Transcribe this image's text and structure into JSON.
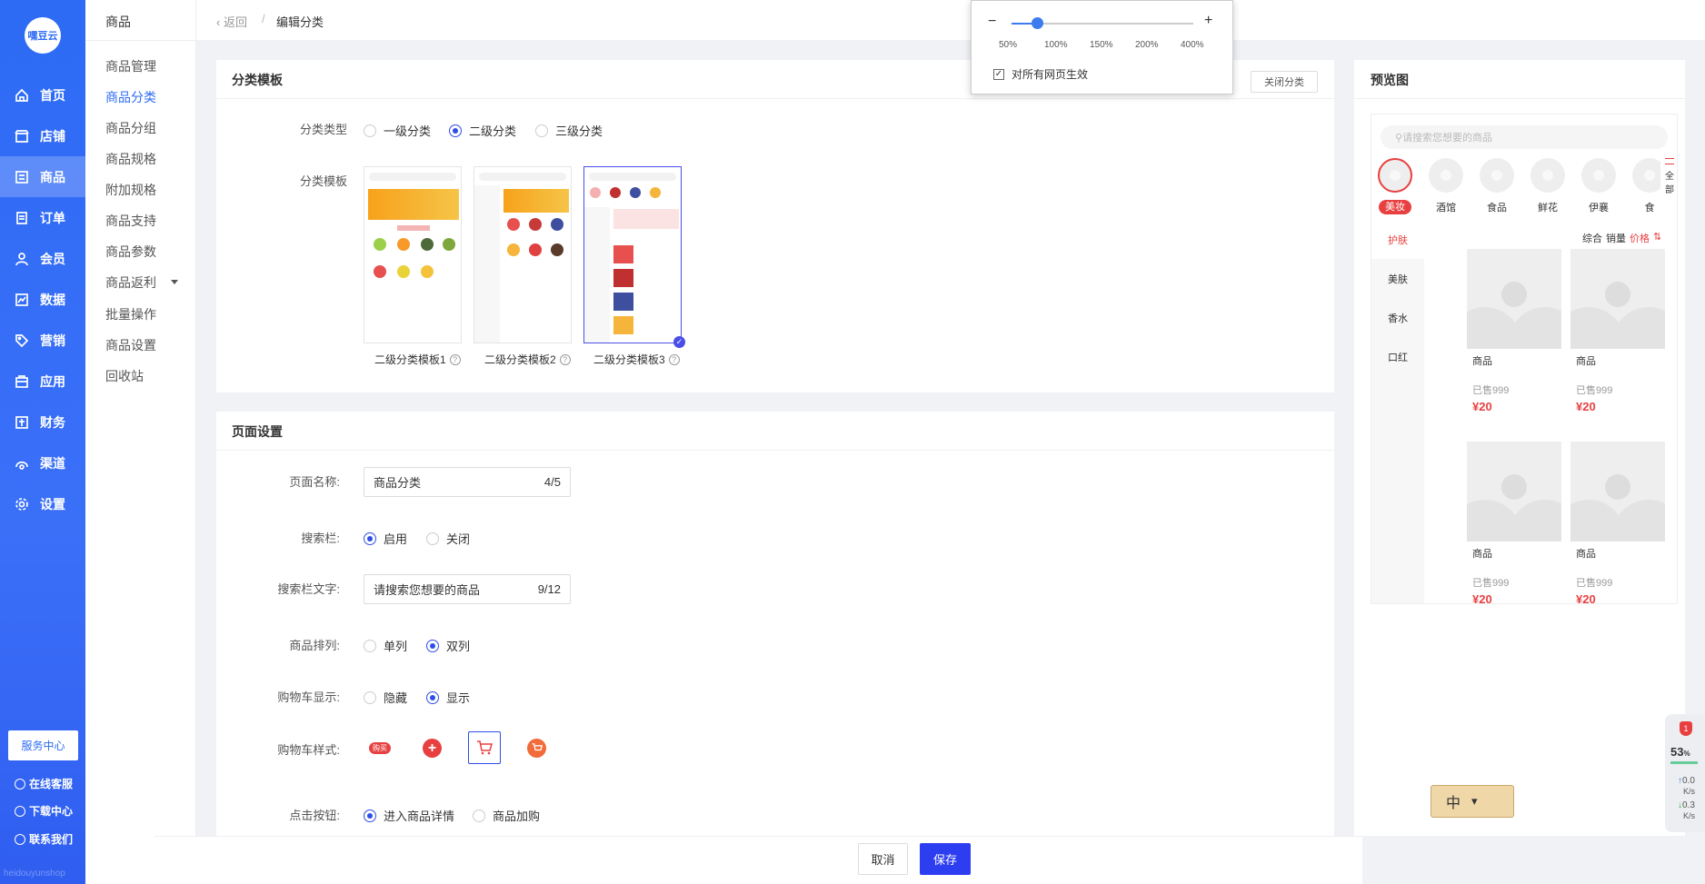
{
  "brand": {
    "logo_text": "嘿豆云",
    "watermark": "heidouyunshop"
  },
  "main_nav": [
    {
      "label": "首页",
      "icon": "home-icon"
    },
    {
      "label": "店铺",
      "icon": "store-icon"
    },
    {
      "label": "商品",
      "icon": "goods-icon",
      "active": true
    },
    {
      "label": "订单",
      "icon": "order-icon"
    },
    {
      "label": "会员",
      "icon": "member-icon"
    },
    {
      "label": "数据",
      "icon": "data-icon"
    },
    {
      "label": "营销",
      "icon": "tag-icon"
    },
    {
      "label": "应用",
      "icon": "app-icon"
    },
    {
      "label": "财务",
      "icon": "finance-icon"
    },
    {
      "label": "渠道",
      "icon": "channel-icon"
    },
    {
      "label": "设置",
      "icon": "gear-icon"
    }
  ],
  "sidebar_bottom": {
    "service_center": "服务中心",
    "links": [
      "在线客服",
      "下载中心",
      "联系我们"
    ]
  },
  "subnav": {
    "title": "商品",
    "items": [
      "商品管理",
      "商品分类",
      "商品分组",
      "商品规格",
      "附加规格",
      "商品支持",
      "商品参数",
      "商品返利",
      "批量操作",
      "商品设置",
      "回收站"
    ],
    "active_index": 1
  },
  "breadcrumb": {
    "back": "返回",
    "sep": "/",
    "current": "编辑分类"
  },
  "zoom_popup": {
    "minus": "−",
    "plus": "+",
    "ticks": [
      "50%",
      "100%",
      "150%",
      "200%",
      "400%"
    ],
    "level_fraction": 0.14,
    "apply_all_label": "对所有网页生效",
    "apply_all_checked": true
  },
  "category_template": {
    "title": "分类模板",
    "close_button": "关闭分类",
    "type_label": "分类类型",
    "type_options": [
      "一级分类",
      "二级分类",
      "三级分类"
    ],
    "type_selected": 1,
    "template_label": "分类模板",
    "templates": [
      "二级分类模板1",
      "二级分类模板2",
      "二级分类模板3"
    ],
    "template_selected": 2,
    "help_glyph": "?"
  },
  "page_settings": {
    "title": "页面设置",
    "page_name_label": "页面名称:",
    "page_name_value": "商品分类",
    "page_name_count": "4/5",
    "search_label": "搜索栏:",
    "search_options": [
      "启用",
      "关闭"
    ],
    "search_selected": 0,
    "search_text_label": "搜索栏文字:",
    "search_text_value": "请搜索您想要的商品",
    "search_text_count": "9/12",
    "layout_label": "商品排列:",
    "layout_options": [
      "单列",
      "双列"
    ],
    "layout_selected": 1,
    "cart_display_label": "购物车显示:",
    "cart_display_options": [
      "隐藏",
      "显示"
    ],
    "cart_display_selected": 1,
    "cart_style_label": "购物车样式:",
    "cart_style_text": "购买",
    "cart_style_selected": 2,
    "click_label": "点击按钮:",
    "click_options": [
      "进入商品详情",
      "商品加购"
    ],
    "click_selected": 0
  },
  "footer": {
    "cancel": "取消",
    "save": "保存"
  },
  "preview": {
    "title": "预览图",
    "search_placeholder": "请搜索您想要的商品",
    "top_categories": [
      "美妆",
      "酒馆",
      "食品",
      "鲜花",
      "伊襄",
      "食"
    ],
    "all_label_1": "全",
    "all_label_2": "部",
    "left_categories": [
      "护肤",
      "美肤",
      "香水",
      "口红"
    ],
    "sort_labels": [
      "综合",
      "销量",
      "价格"
    ],
    "products": [
      {
        "name": "商品",
        "sold": "已售999",
        "price": "¥20"
      },
      {
        "name": "商品",
        "sold": "已售999",
        "price": "¥20"
      },
      {
        "name": "商品",
        "sold": "已售999",
        "price": "¥20"
      },
      {
        "name": "商品",
        "sold": "已售999",
        "price": "¥20"
      }
    ]
  },
  "monitor": {
    "badge": "1",
    "percent": "53",
    "pct_sign": "%",
    "up": "0.0",
    "down": "0.3",
    "unit": "K/s"
  },
  "ime": {
    "label": "中"
  },
  "colors": {
    "primary": "#2d6bf5",
    "accent": "#2d4ee8",
    "danger": "#e84040"
  }
}
